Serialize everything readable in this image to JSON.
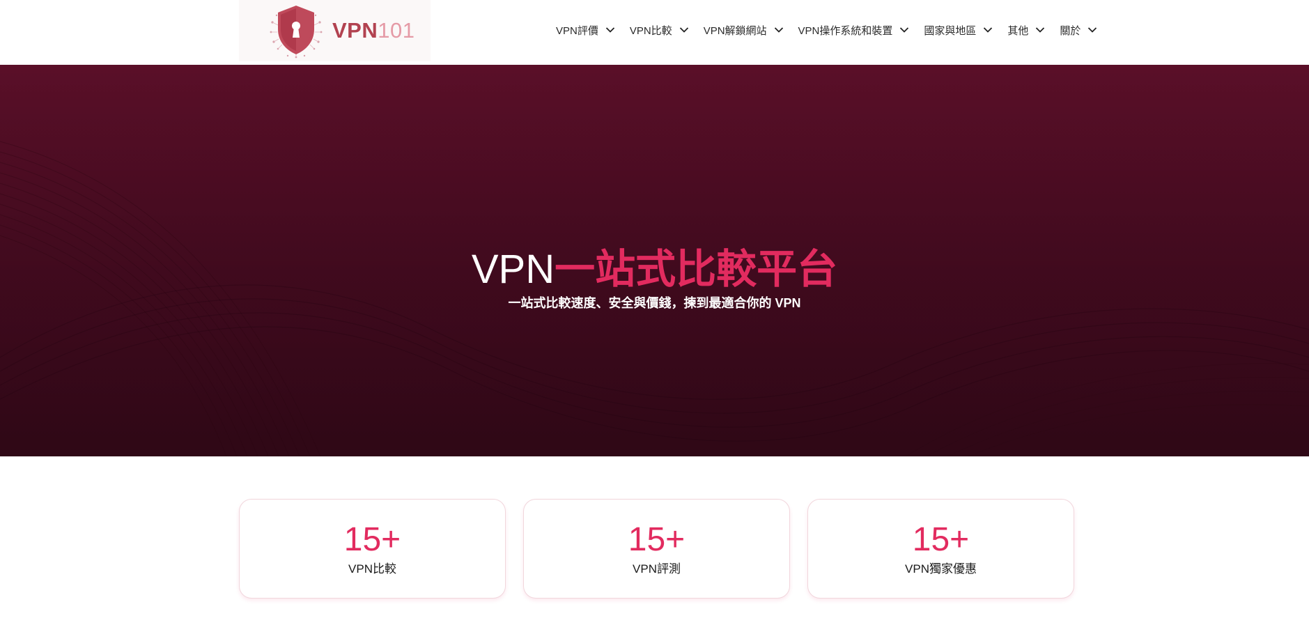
{
  "header": {
    "logo": {
      "vpn_text": "VPN",
      "num_text": "101"
    },
    "nav": [
      {
        "label": "VPN評價"
      },
      {
        "label": "VPN比較"
      },
      {
        "label": "VPN解鎖網站"
      },
      {
        "label": "VPN操作系統和裝置"
      },
      {
        "label": "國家與地區"
      },
      {
        "label": "其他"
      },
      {
        "label": "關於"
      }
    ]
  },
  "hero": {
    "title_white": "VPN",
    "title_accent": "一站式比較平台",
    "subtitle": "一站式比較速度、安全與價錢，揀到最適合你的 VPN"
  },
  "stats": [
    {
      "value": "15+",
      "label": "VPN比較"
    },
    {
      "value": "15+",
      "label": "VPN評測"
    },
    {
      "value": "15+",
      "label": "VPN獨家優惠"
    }
  ],
  "colors": {
    "accent": "#e22b5f",
    "hero_bg": "#4c0c23",
    "logo_red": "#b24250"
  }
}
